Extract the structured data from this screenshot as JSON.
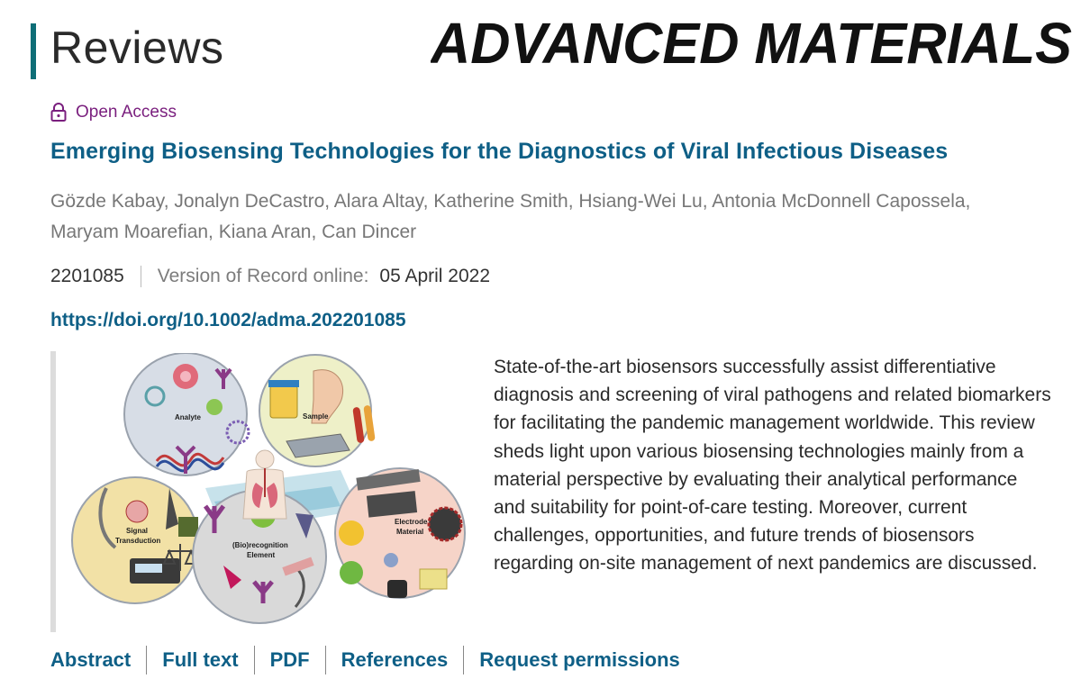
{
  "section": {
    "title": "Reviews"
  },
  "journal": {
    "name": "ADVANCED MATERIALS"
  },
  "access": {
    "label": "Open Access",
    "icon": "lock-icon",
    "color": "#7a1f7e"
  },
  "article": {
    "title": "Emerging Biosensing Technologies for the Diagnostics of Viral Infectious Diseases",
    "authors": "Gözde Kabay, Jonalyn DeCastro, Alara Altay, Katherine Smith, Hsiang-Wei Lu, Antonia McDonnell Capossela, Maryam Moarefian, Kiana Aran, Can Dincer",
    "article_number": "2201085",
    "version_label": "Version of Record online:",
    "date": "05 April 2022",
    "doi": "https://doi.org/10.1002/adma.202201085",
    "abstract": "State-of-the-art biosensors successfully assist differentiative diagnosis and screening of viral pathogens and related biomarkers for facilitating the pandemic management worldwide. This review sheds light upon various biosensing technologies mainly from a material perspective by evaluating their analytical performance and suitability for point-of-care testing. Moreover, current challenges, opportunities, and future trends of biosensors regarding on-site management of next pandemics are discussed."
  },
  "figure": {
    "labels": {
      "analyte": "Analyte",
      "sample": "Sample",
      "signal_1": "Signal",
      "signal_2": "Transduction",
      "recog_1": "(Bio)recognition",
      "recog_2": "Element",
      "electrode_1": "Electrode",
      "electrode_2": "Material"
    }
  },
  "links": [
    {
      "label": "Abstract"
    },
    {
      "label": "Full text"
    },
    {
      "label": "PDF"
    },
    {
      "label": "References"
    },
    {
      "label": "Request permissions"
    }
  ],
  "colors": {
    "accent": "#0e6e77",
    "link": "#0e5f86",
    "open_access": "#7a1f7e"
  }
}
